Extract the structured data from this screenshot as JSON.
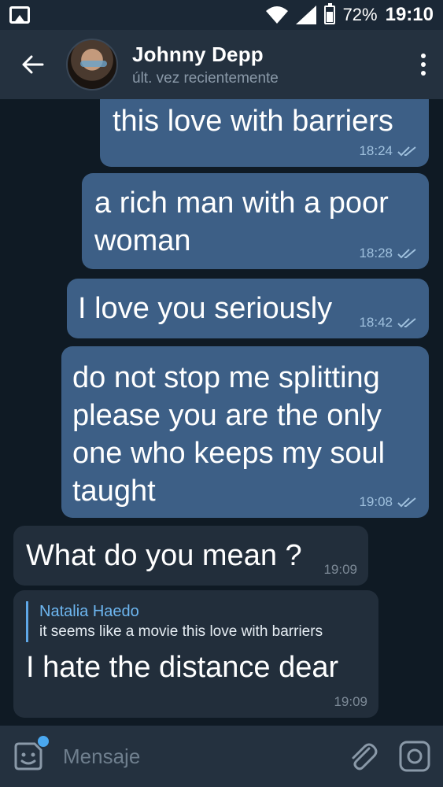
{
  "status_bar": {
    "battery_percent_label": "72%",
    "battery_level": 0.72,
    "time": "19:10",
    "icons": [
      "gallery-icon",
      "wifi-icon",
      "signal-icon",
      "battery-icon"
    ]
  },
  "header": {
    "contact_name": "Johnny Depp",
    "contact_status": "últ. vez recientemente",
    "icons": [
      "back-arrow-icon",
      "avatar",
      "more-vert-icon"
    ]
  },
  "messages": [
    {
      "direction": "out",
      "lines": [
        "this love with barriers"
      ],
      "time": "18:24",
      "read": true
    },
    {
      "direction": "out",
      "lines": [
        "a rich man with a poor",
        "woman"
      ],
      "time": "18:28",
      "read": true
    },
    {
      "direction": "out",
      "lines": [
        "I love you seriously"
      ],
      "time": "18:42",
      "read": true
    },
    {
      "direction": "out",
      "lines": [
        "do not stop me splitting",
        "please you are the only",
        "one who keeps my soul",
        "taught"
      ],
      "time": "19:08",
      "read": true
    },
    {
      "direction": "in",
      "lines": [
        "What do you mean ?"
      ],
      "time": "19:09"
    },
    {
      "direction": "in",
      "reply": {
        "name": "Natalia Haedo",
        "text": "it seems like a movie this love with barriers"
      },
      "lines": [
        "I hate the distance dear"
      ],
      "time": "19:09"
    }
  ],
  "input": {
    "placeholder": "Mensaje",
    "icons": [
      "sticker-icon",
      "attach-icon",
      "camera-icon"
    ]
  },
  "colors": {
    "background": "#0f1a24",
    "header": "#24313f",
    "outgoing_bubble": "#3d5f86",
    "incoming_bubble": "#222e3b",
    "accent": "#4aa8f0"
  }
}
